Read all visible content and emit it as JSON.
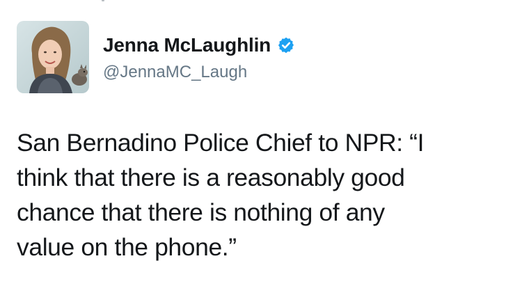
{
  "tweet": {
    "author": {
      "display_name": "Jenna McLaughlin",
      "handle": "@JennaMC_Laugh",
      "verified": true
    },
    "text": "San Bernadino Police Chief to NPR: “I\nthink that there is a reasonably good\nchance that there is nothing of any\nvalue on the phone.”"
  },
  "icons": {
    "verified": "verified-badge-icon",
    "avatar": "profile-photo"
  },
  "colors": {
    "text": "#14171a",
    "handle": "#657786",
    "verified": "#1da1f2",
    "background": "#ffffff"
  }
}
